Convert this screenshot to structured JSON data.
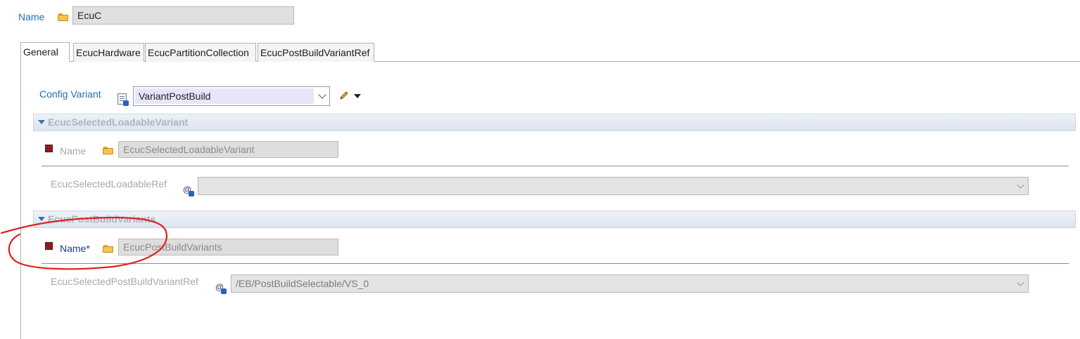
{
  "header": {
    "name_label": "Name",
    "name_value": "EcuC"
  },
  "tabs": [
    {
      "label": "General",
      "active": true
    },
    {
      "label": "EcucHardware",
      "active": false
    },
    {
      "label": "EcucPartitionCollection",
      "active": false
    },
    {
      "label": "EcucPostBuildVariantRef",
      "active": false
    }
  ],
  "general": {
    "config_variant_label": "Config Variant",
    "config_variant_value": "VariantPostBuild",
    "section_loadable": {
      "title": "EcucSelectedLoadableVariant",
      "name_label": "Name",
      "name_value": "EcucSelectedLoadableVariant",
      "ref_label": "EcucSelectedLoadableRef",
      "ref_value": ""
    },
    "section_postbuild": {
      "title": "EcucPostBuildVariants",
      "name_label": "Name*",
      "name_value": "EcucPostBuildVariants",
      "ref_label": "EcucSelectedPostBuildVariantRef",
      "ref_value": "/EB/PostBuildSelectable/VS_0"
    }
  },
  "colors": {
    "label_blue": "#1f6fb5",
    "annotation_red": "#e0201e",
    "required_square": "#8b1d1d"
  },
  "icons": [
    "folder-icon",
    "doc-variant-icon",
    "edit-pencil-icon",
    "dropdown-arrow-icon",
    "reference-icon",
    "collapse-triangle-icon",
    "required-marker-icon"
  ]
}
